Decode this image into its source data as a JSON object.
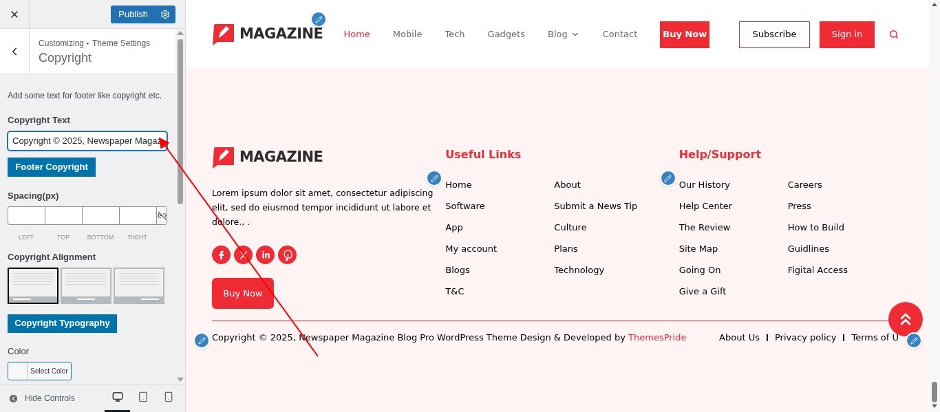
{
  "customizer": {
    "publish_label": "Publish",
    "breadcrumb": [
      "Customizing",
      "Theme Settings"
    ],
    "breadcrumb_separator": "▸",
    "title": "Copyright",
    "description": "Add some text for footer like copyright etc.",
    "copyright_text": {
      "label": "Copyright Text",
      "value": "Copyright © 2025, Newspaper Magaz"
    },
    "footer_copyright_button": "Footer Copyright",
    "spacing": {
      "label": "Spacing(px)",
      "sides": [
        "LEFT",
        "TOP",
        "BOTTOM",
        "RIGHT"
      ]
    },
    "alignment": {
      "label": "Copyright Alignment",
      "options": [
        {
          "kind": "left",
          "selected": true
        },
        {
          "kind": "center",
          "selected": false
        },
        {
          "kind": "right",
          "selected": false
        }
      ]
    },
    "typography_button": "Copyright Typography",
    "color": {
      "label": "Color",
      "button": "Select Color"
    },
    "bottom_bar": {
      "hide_label": "Hide Controls",
      "devices": [
        {
          "kind": "desktop",
          "selected": true
        },
        {
          "kind": "tablet",
          "selected": false
        },
        {
          "kind": "mobile",
          "selected": false
        }
      ]
    }
  },
  "site": {
    "header": {
      "logo": "MAGAZINE",
      "nav": [
        {
          "label": "Home",
          "selected": true,
          "has_menu": false
        },
        {
          "label": "Mobile",
          "selected": false,
          "has_menu": false
        },
        {
          "label": "Tech",
          "selected": false,
          "has_menu": false
        },
        {
          "label": "Gadgets",
          "selected": false,
          "has_menu": false
        },
        {
          "label": "Blog",
          "selected": false,
          "has_menu": true
        },
        {
          "label": "Contact",
          "selected": false,
          "has_menu": false
        }
      ],
      "buy_now": "Buy Now",
      "subscribe": "Subscribe",
      "sign_in": "Sign in"
    },
    "footer": {
      "logo": "MAGAZINE",
      "about": "Lorem ipsum dolor sit amet, consectetur adipiscing elit, sed do eiusmod tempor incididunt ut labore et dolore., .",
      "socials": [
        {
          "kind": "facebook"
        },
        {
          "kind": "x"
        },
        {
          "kind": "linkedin"
        },
        {
          "kind": "pinterest"
        }
      ],
      "buy_now": "Buy Now",
      "columns": [
        {
          "heading": "Useful Links",
          "links": [
            [
              "Home",
              "Software",
              "App",
              "My account",
              "Blogs",
              "T&C"
            ],
            [
              "About",
              "Submit a News Tip",
              "Culture",
              "Plans",
              "Technology"
            ]
          ]
        },
        {
          "heading": "Help/Support",
          "links": [
            [
              "Our History",
              "Help Center",
              "The Review",
              "Site Map",
              "Going On",
              "Give a Gift"
            ],
            [
              "Careers",
              "Press",
              "How to Build",
              "Guidlines",
              "Figital Access"
            ]
          ]
        }
      ],
      "copyright": "Copyright © 2025, Newspaper Magazine Blog Pro WordPress Theme Design & Developed by",
      "credit": "ThemesPride",
      "bottom_links": [
        "About Us",
        "Privacy policy",
        "Terms of U"
      ]
    }
  }
}
